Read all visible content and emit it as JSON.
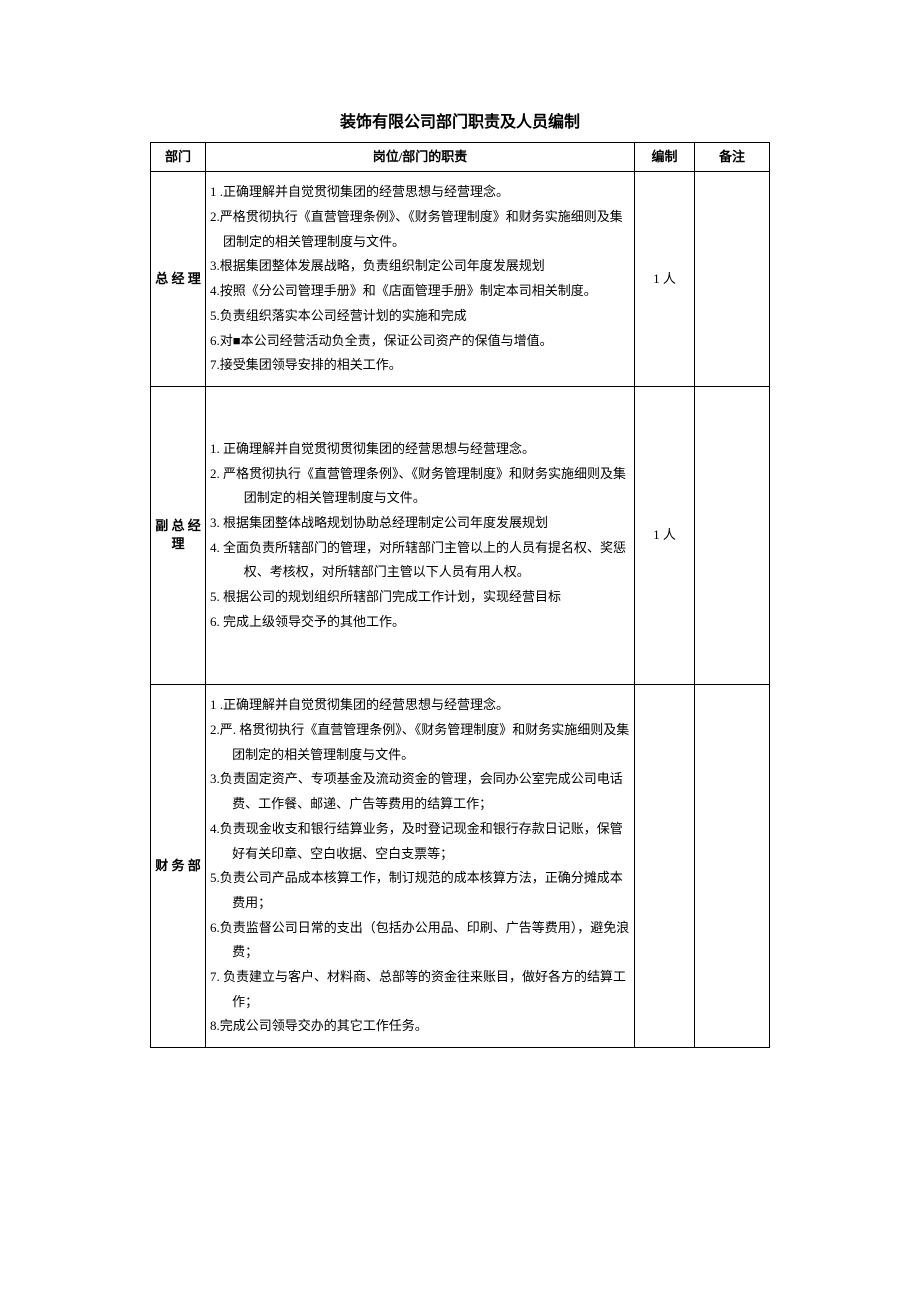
{
  "title": "装饰有限公司部门职责及人员编制",
  "headers": {
    "dept": "部门",
    "duty": "岗位/部门的职责",
    "count": "编制",
    "remark": "备注"
  },
  "rows": [
    {
      "dept": "总 经 理",
      "count": "1 人",
      "remark": "",
      "duties": [
        "1           .正确理解并自觉贯彻集团的经营思想与经营理念。",
        "2.严格贯彻执行《直营管理条例》、《财务管理制度》和财务实施细则及集团制定的相关管理制度与文件。",
        "3.根据集团整体发展战略，负责组织制定公司年度发展规划",
        "4.按照《分公司管理手册》和《店面管理手册》制定本司相关制度。",
        "5.负责组织落实本公司经营计划的实施和完成",
        "6.对■本公司经营活动负全责，保证公司资产的保值与增值。",
        "7.接受集团领导安排的相关工作。"
      ]
    },
    {
      "dept": "副 总 经理",
      "count": "1 人",
      "remark": "",
      "duties": [
        "1.      正确理解并自觉贯彻贯彻集团的经营思想与经营理念。",
        "2.      严格贯彻执行《直营管理条例》、《财务管理制度》和财务实施细则及集团制定的相关管理制度与文件。",
        "3.      根据集团整体战略规划协助总经理制定公司年度发展规划",
        "4.      全面负责所辖部门的管理，对所辖部门主管以上的人员有提名权、奖惩权、考核权，对所辖部门主管以下人员有用人权。",
        "5.      根据公司的规划组织所辖部门完成工作计划，实现经营目标",
        "6.      完成上级领导交予的其他工作。"
      ]
    },
    {
      "dept": "财 务 部",
      "count": "",
      "remark": "",
      "duties": [
        "1           .正确理解并自觉贯彻集团的经营思想与经营理念。",
        "2.严. 格贯彻执行《直营管理条例》、《财务管理制度》和财务实施细则及集团制定的相关管理制度与文件。",
        "3.负责固定资产、专项基金及流动资金的管理，会同办公室完成公司电话费、工作餐、邮递、广告等费用的结算工作；",
        "4.负责现金收支和银行结算业务，及时登记现金和银行存款日记账，保管好有关印章、空白收据、空白支票等；",
        "5.负责公司产品成本核算工作，制订规范的成本核算方法，正确分摊成本费用；",
        "6.负责监督公司日常的支出（包括办公用品、印刷、广告等费用），避免浪费；",
        "7. 负责建立与客户、材料商、总部等的资金往来账目，做好各方的结算工作；",
        "8.完成公司领导交办的其它工作任务。"
      ]
    }
  ]
}
